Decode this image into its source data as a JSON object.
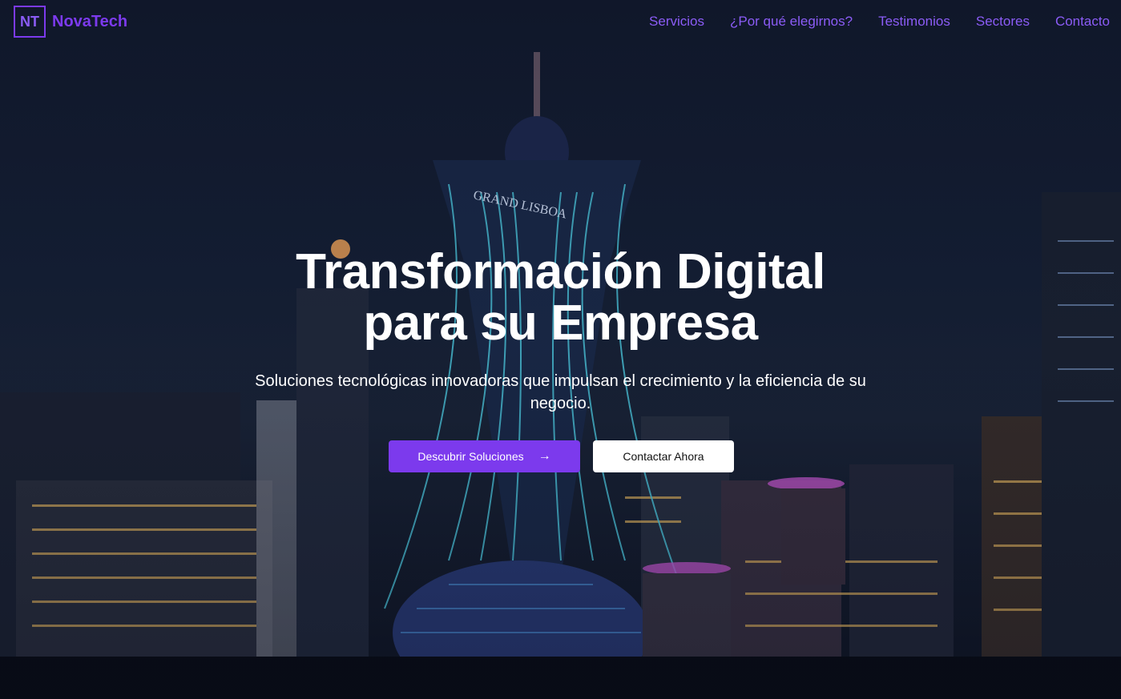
{
  "brand": {
    "mark": "NT",
    "name": "NovaTech",
    "accent": "#7c3aed"
  },
  "nav": {
    "items": [
      {
        "label": "Servicios"
      },
      {
        "label": "¿Por qué elegirnos?"
      },
      {
        "label": "Testimonios"
      },
      {
        "label": "Sectores"
      },
      {
        "label": "Contacto"
      }
    ]
  },
  "hero": {
    "background": "night-city-skyline-image",
    "sign_text": "GRAND LISBOA",
    "title": "Transformación Digital para su Empresa",
    "subtitle": "Soluciones tecnológicas innovadoras que impulsan el crecimiento y la eficiencia de su negocio.",
    "primary_cta": "Descubrir Soluciones",
    "primary_icon": "arrow-right-icon",
    "secondary_cta": "Contactar Ahora"
  }
}
